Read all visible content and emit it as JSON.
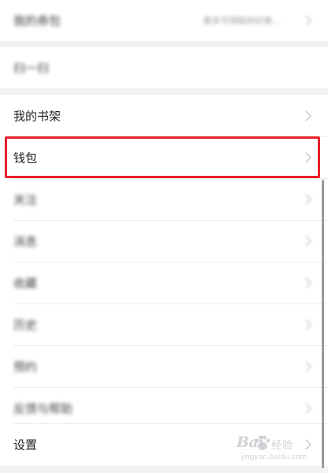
{
  "groups": [
    {
      "items": [
        {
          "label": "我的券包",
          "value": "更多可领取的好券..."
        }
      ]
    },
    {
      "items": [
        {
          "label": "扫一扫"
        }
      ]
    },
    {
      "items": [
        {
          "label": "我的书架"
        },
        {
          "label": "钱包"
        },
        {
          "label": "关注"
        },
        {
          "label": "消息"
        },
        {
          "label": "收藏"
        },
        {
          "label": "历史"
        },
        {
          "label": "预约"
        },
        {
          "label": "反馈与帮助"
        },
        {
          "label": "设置"
        }
      ]
    }
  ],
  "watermark": {
    "logo_text": "Bai",
    "logo_suffix": "经验",
    "url": "jingyan.baidu.com"
  },
  "colors": {
    "highlight": "#e8202a",
    "background": "#f2f2f4",
    "row": "#ffffff"
  },
  "icons": {
    "chevron": "chevron-right-icon",
    "watermark_paw": "paw-icon"
  }
}
